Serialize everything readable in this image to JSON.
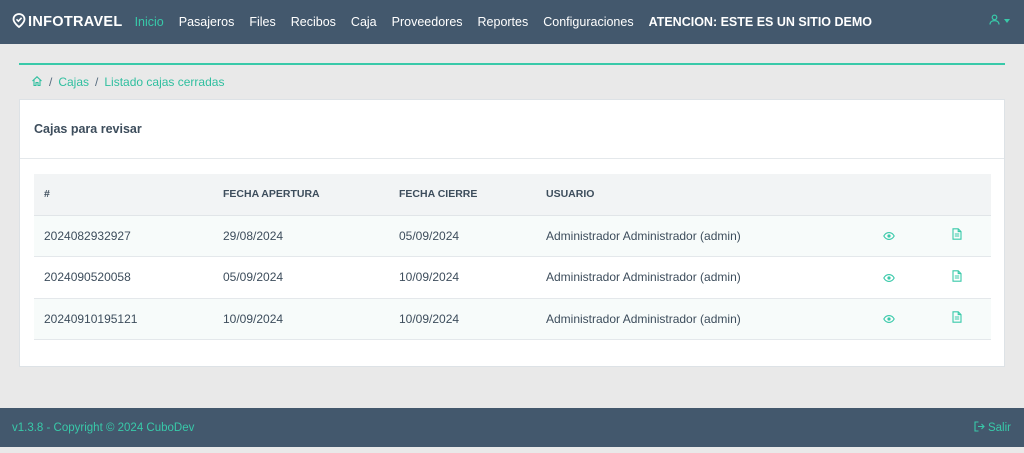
{
  "brand": {
    "name": "INFOTRAVEL",
    "icon": "location-pin-check-icon"
  },
  "nav": {
    "items": [
      "Inicio",
      "Pasajeros",
      "Files",
      "Recibos",
      "Caja",
      "Proveedores",
      "Reportes",
      "Configuraciones"
    ],
    "active": "Inicio",
    "notice": "ATENCION: ESTE ES UN SITIO DEMO"
  },
  "user_menu": {
    "icon": "user-icon"
  },
  "breadcrumb": {
    "home_icon": "home-icon",
    "items": [
      "Cajas",
      "Listado cajas cerradas"
    ]
  },
  "card": {
    "title": "Cajas para revisar",
    "table": {
      "headers": [
        "#",
        "FECHA APERTURA",
        "FECHA CIERRE",
        "USUARIO"
      ],
      "rows": [
        {
          "id": "2024082932927",
          "apertura": "29/08/2024",
          "cierre": "05/09/2024",
          "usuario": "Administrador Administrador (admin)"
        },
        {
          "id": "2024090520058",
          "apertura": "05/09/2024",
          "cierre": "10/09/2024",
          "usuario": "Administrador Administrador (admin)"
        },
        {
          "id": "20240910195121",
          "apertura": "10/09/2024",
          "cierre": "10/09/2024",
          "usuario": "Administrador Administrador (admin)"
        }
      ],
      "row_actions": [
        "eye-icon",
        "document-icon"
      ]
    }
  },
  "footer": {
    "text": "v1.3.8 - Copyright © 2024 CuboDev",
    "logout_label": "Salir",
    "logout_icon": "logout-icon"
  },
  "colors": {
    "topbar": "#43586d",
    "accent": "#38c9a9",
    "background": "#e9e9e9"
  }
}
